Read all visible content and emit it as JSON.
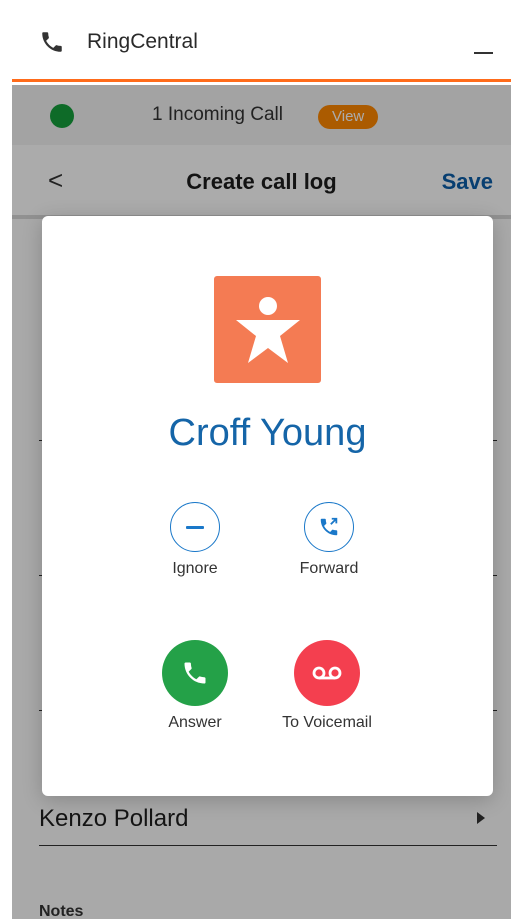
{
  "window": {
    "title": "RingCentral",
    "phone_icon": "phone-icon",
    "minimize_icon": "minimize-icon"
  },
  "incoming_bar": {
    "status_color": "#15a03c",
    "text": "1 Incoming Call",
    "view_label": "View"
  },
  "header": {
    "back_label": "<",
    "title": "Create call log",
    "save_label": "Save"
  },
  "form": {
    "contact_value": "Kenzo Pollard",
    "notes_label": "Notes"
  },
  "incoming_call_modal": {
    "caller_name": "Croff Young",
    "avatar_icon": "person-icon",
    "avatar_color": "#f47b53",
    "actions": {
      "ignore_label": "Ignore",
      "forward_label": "Forward",
      "answer_label": "Answer",
      "voicemail_label": "To Voicemail"
    },
    "colors": {
      "answer": "#24a148",
      "voicemail": "#f43f4f",
      "accent": "#1a78c9"
    }
  },
  "brand_color": "#ff6b1a"
}
